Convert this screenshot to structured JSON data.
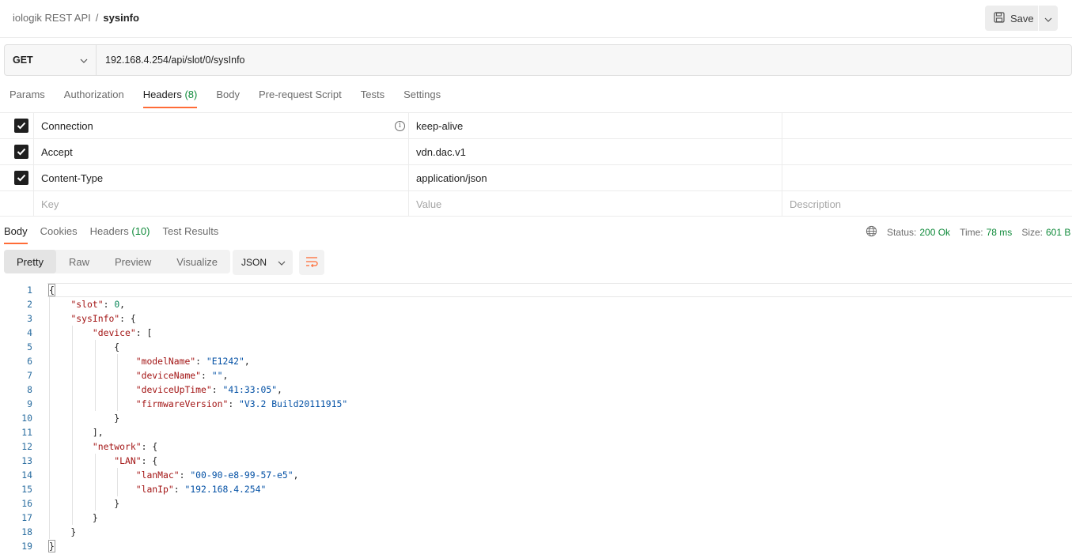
{
  "breadcrumb": {
    "collection": "iologik REST API",
    "separator": "/",
    "request": "sysinfo"
  },
  "save": {
    "label": "Save",
    "icon": "floppy-disk-icon"
  },
  "request": {
    "method": "GET",
    "url": "192.168.4.254/api/slot/0/sysInfo"
  },
  "request_tabs": [
    {
      "label": "Params",
      "count": ""
    },
    {
      "label": "Authorization",
      "count": ""
    },
    {
      "label": "Headers",
      "count": "(8)"
    },
    {
      "label": "Body",
      "count": ""
    },
    {
      "label": "Pre-request Script",
      "count": ""
    },
    {
      "label": "Tests",
      "count": ""
    },
    {
      "label": "Settings",
      "count": ""
    }
  ],
  "headers": {
    "rows": [
      {
        "key": "Connection",
        "value": "keep-alive",
        "description": ""
      },
      {
        "key": "Accept",
        "value": "vdn.dac.v1",
        "description": ""
      },
      {
        "key": "Content-Type",
        "value": "application/json",
        "description": ""
      }
    ],
    "placeholders": {
      "key": "Key",
      "value": "Value",
      "description": "Description"
    }
  },
  "response_tabs": [
    {
      "label": "Body",
      "count": ""
    },
    {
      "label": "Cookies",
      "count": ""
    },
    {
      "label": "Headers",
      "count": "(10)"
    },
    {
      "label": "Test Results",
      "count": ""
    }
  ],
  "response_status": {
    "status_label": "Status:",
    "status_value": "200 Ok",
    "time_label": "Time:",
    "time_value": "78 ms",
    "size_label": "Size:",
    "size_value": "601 B"
  },
  "view_modes": [
    "Pretty",
    "Raw",
    "Preview",
    "Visualize"
  ],
  "format": "JSON",
  "code_lines": [
    "{",
    "    \"slot\": 0,",
    "    \"sysInfo\": {",
    "        \"device\": [",
    "            {",
    "                \"modelName\": \"E1242\",",
    "                \"deviceName\": \"\",",
    "                \"deviceUpTime\": \"41:33:05\",",
    "                \"firmwareVersion\": \"V3.2 Build20111915\"",
    "            }",
    "        ],",
    "        \"network\": {",
    "            \"LAN\": {",
    "                \"lanMac\": \"00-90-e8-99-57-e5\",",
    "                \"lanIp\": \"192.168.4.254\"",
    "            }",
    "        }",
    "    }",
    "}"
  ],
  "colors": {
    "accent": "#ff6c37",
    "status_ok": "#0f8a3a",
    "json_key": "#a31515",
    "json_string": "#0451a5",
    "json_number": "#098658",
    "line_number": "#2a6da0"
  }
}
